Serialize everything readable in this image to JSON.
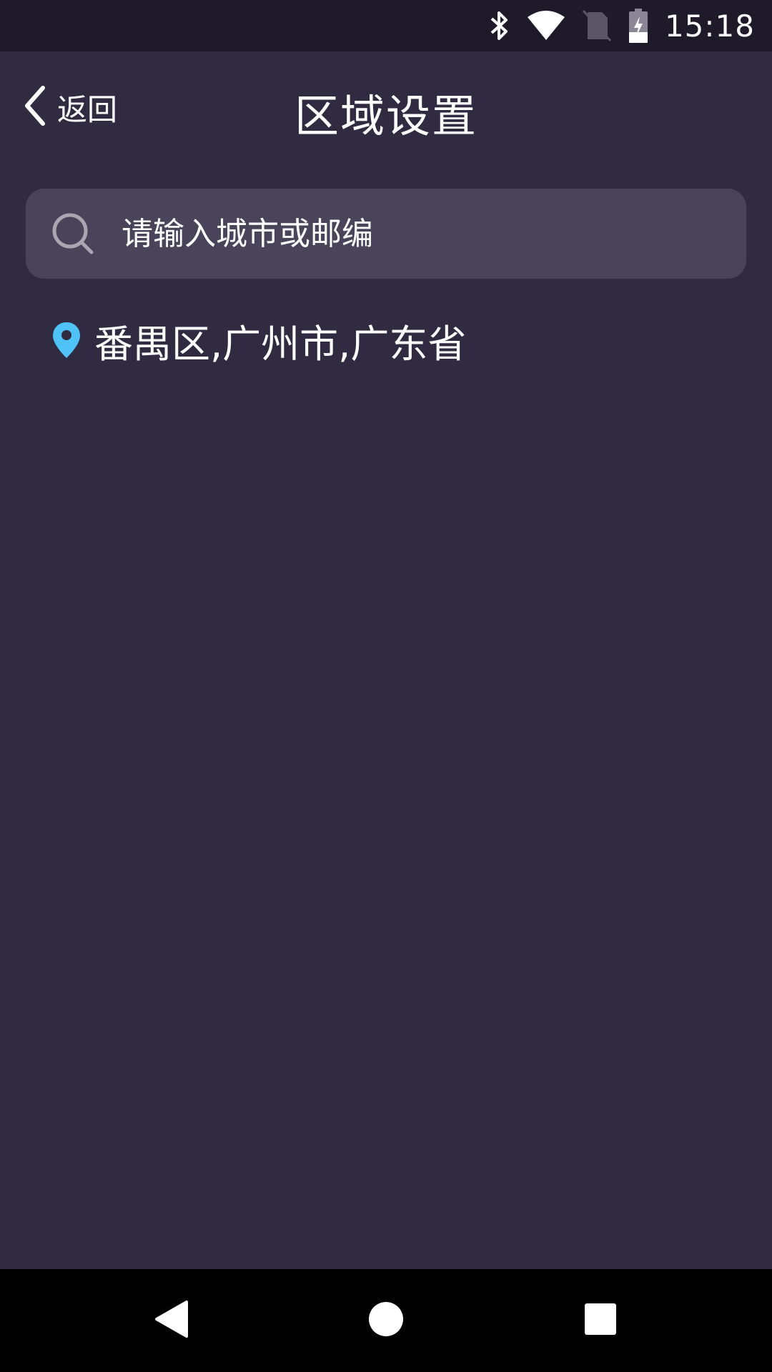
{
  "status_bar": {
    "time": "15:18",
    "icons": [
      "bluetooth-icon",
      "wifi-icon",
      "no-sim-icon",
      "battery-charging-icon"
    ]
  },
  "header": {
    "back_label": "返回",
    "title": "区域设置"
  },
  "search": {
    "placeholder": "请输入城市或邮编",
    "value": ""
  },
  "location": {
    "text": "番禺区,广州市,广东省",
    "pin_color": "#4fc3f7"
  },
  "nav_bar": {
    "buttons": [
      "back-triangle-icon",
      "home-circle-icon",
      "recent-apps-square-icon"
    ]
  },
  "colors": {
    "background": "#302b40",
    "status_bar": "#1e1a29",
    "search_box": "#49445a",
    "nav_bar": "#000000"
  }
}
